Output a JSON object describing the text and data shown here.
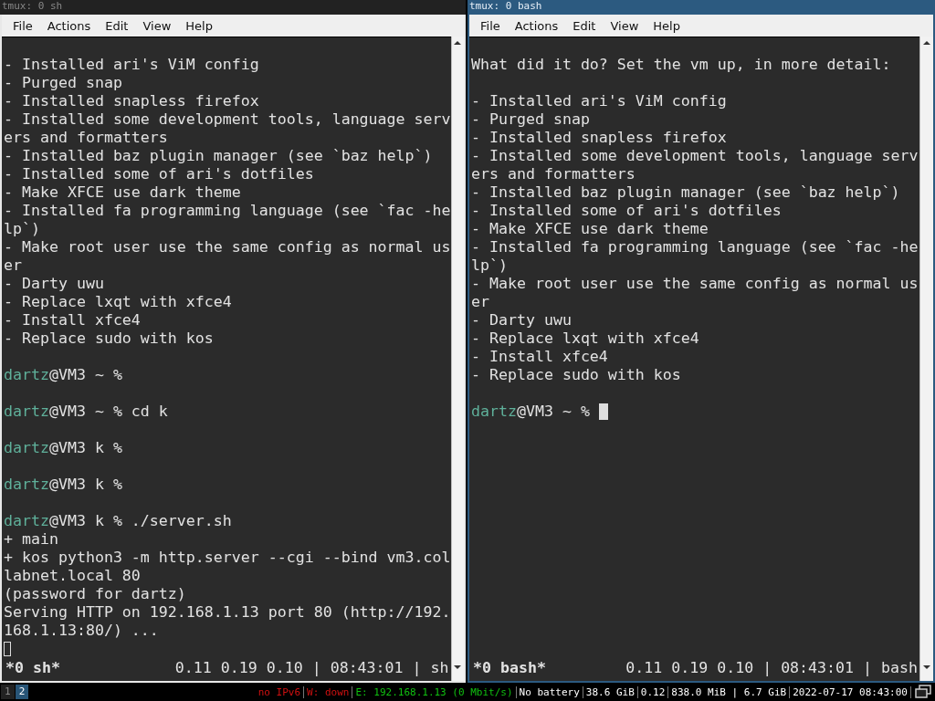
{
  "windows": [
    {
      "title": "tmux: 0 sh",
      "focused": false,
      "menu": [
        "File",
        "Actions",
        "Edit",
        "View",
        "Help"
      ],
      "lines": [
        {
          "kind": "blank"
        },
        {
          "kind": "text",
          "text": "- Installed ari's ViM config"
        },
        {
          "kind": "text",
          "text": "- Purged snap"
        },
        {
          "kind": "text",
          "text": "- Installed snapless firefox"
        },
        {
          "kind": "text",
          "text": "- Installed some development tools, language serv"
        },
        {
          "kind": "text",
          "text": "ers and formatters"
        },
        {
          "kind": "text",
          "text": "- Installed baz plugin manager (see `baz help`)"
        },
        {
          "kind": "text",
          "text": "- Installed some of ari's dotfiles"
        },
        {
          "kind": "text",
          "text": "- Make XFCE use dark theme"
        },
        {
          "kind": "text",
          "text": "- Installed fa programming language (see `fac -he"
        },
        {
          "kind": "text",
          "text": "lp`)"
        },
        {
          "kind": "text",
          "text": "- Make root user use the same config as normal us"
        },
        {
          "kind": "text",
          "text": "er"
        },
        {
          "kind": "text",
          "text": "- Darty uwu"
        },
        {
          "kind": "text",
          "text": "- Replace lxqt with xfce4"
        },
        {
          "kind": "text",
          "text": "- Install xfce4"
        },
        {
          "kind": "text",
          "text": "- Replace sudo with kos"
        },
        {
          "kind": "blank"
        },
        {
          "kind": "prompt",
          "user": "dartz",
          "text": "@VM3 ~ %",
          "cursor": false
        },
        {
          "kind": "blank"
        },
        {
          "kind": "prompt",
          "user": "dartz",
          "text": "@VM3 ~ % cd k",
          "cursor": false
        },
        {
          "kind": "blank"
        },
        {
          "kind": "prompt",
          "user": "dartz",
          "text": "@VM3 k %",
          "cursor": false
        },
        {
          "kind": "blank"
        },
        {
          "kind": "prompt",
          "user": "dartz",
          "text": "@VM3 k %",
          "cursor": false
        },
        {
          "kind": "blank"
        },
        {
          "kind": "prompt",
          "user": "dartz",
          "text": "@VM3 k % ./server.sh",
          "cursor": false
        },
        {
          "kind": "text",
          "text": "+ main"
        },
        {
          "kind": "text",
          "text": "+ kos python3 -m http.server --cgi --bind vm3.col"
        },
        {
          "kind": "text",
          "text": "labnet.local 80"
        },
        {
          "kind": "text",
          "text": "(password for dartz)"
        },
        {
          "kind": "text",
          "text": "Serving HTTP on 192.168.1.13 port 80 (http://192."
        },
        {
          "kind": "text",
          "text": "168.1.13:80/) ..."
        },
        {
          "kind": "cursor"
        }
      ],
      "status": {
        "session": "*0 sh*",
        "info": "0.11 0.19 0.10 | 08:43:01 | sh"
      }
    },
    {
      "title": "tmux: 0 bash",
      "focused": true,
      "menu": [
        "File",
        "Actions",
        "Edit",
        "View",
        "Help"
      ],
      "lines": [
        {
          "kind": "blank"
        },
        {
          "kind": "text",
          "text": "What did it do? Set the vm up, in more detail:"
        },
        {
          "kind": "blank"
        },
        {
          "kind": "text",
          "text": "- Installed ari's ViM config"
        },
        {
          "kind": "text",
          "text": "- Purged snap"
        },
        {
          "kind": "text",
          "text": "- Installed snapless firefox"
        },
        {
          "kind": "text",
          "text": "- Installed some development tools, language serv"
        },
        {
          "kind": "text",
          "text": "ers and formatters"
        },
        {
          "kind": "text",
          "text": "- Installed baz plugin manager (see `baz help`)"
        },
        {
          "kind": "text",
          "text": "- Installed some of ari's dotfiles"
        },
        {
          "kind": "text",
          "text": "- Make XFCE use dark theme"
        },
        {
          "kind": "text",
          "text": "- Installed fa programming language (see `fac -he"
        },
        {
          "kind": "text",
          "text": "lp`)"
        },
        {
          "kind": "text",
          "text": "- Make root user use the same config as normal us"
        },
        {
          "kind": "text",
          "text": "er"
        },
        {
          "kind": "text",
          "text": "- Darty uwu"
        },
        {
          "kind": "text",
          "text": "- Replace lxqt with xfce4"
        },
        {
          "kind": "text",
          "text": "- Install xfce4"
        },
        {
          "kind": "text",
          "text": "- Replace sudo with kos"
        },
        {
          "kind": "blank"
        },
        {
          "kind": "prompt",
          "user": "dartz",
          "text": "@VM3 ~ %",
          "cursor": true
        }
      ],
      "status": {
        "session": "*0 bash*",
        "info": "0.11 0.19 0.10 | 08:43:01 | bash"
      }
    }
  ],
  "panel": {
    "workspaces": [
      {
        "label": "1",
        "selected": false
      },
      {
        "label": "2",
        "selected": true
      }
    ],
    "segments": [
      {
        "text": "no IPv6",
        "color": "#d01010"
      },
      {
        "text": "W: down",
        "color": "#d01010"
      },
      {
        "text": "E: 192.168.1.13 (0 Mbit/s)",
        "color": "#10c010"
      },
      {
        "text": "No battery",
        "color": "#ffffff"
      },
      {
        "text": "38.6 GiB",
        "color": "#ffffff"
      },
      {
        "text": "0.12",
        "color": "#ffffff"
      },
      {
        "text": "838.0 MiB | 6.7 GiB",
        "color": "#ffffff"
      },
      {
        "text": "2022-07-17 08:43:00",
        "color": "#ffffff"
      }
    ]
  }
}
